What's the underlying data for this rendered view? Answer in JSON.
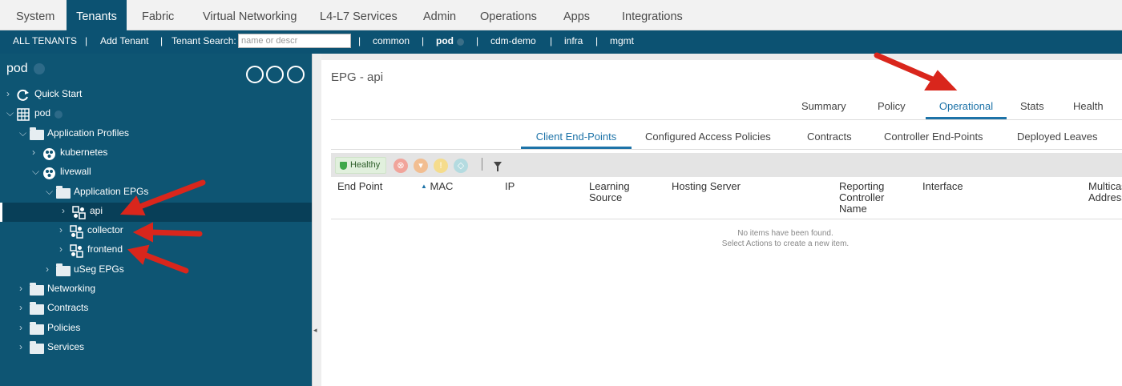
{
  "topnav": {
    "items": [
      "System",
      "Tenants",
      "Fabric",
      "Virtual Networking",
      "L4-L7 Services",
      "Admin",
      "Operations",
      "Apps",
      "Integrations"
    ],
    "active": "Tenants"
  },
  "subnav": {
    "all_tenants": "ALL TENANTS",
    "add_tenant": "Add Tenant",
    "tenant_search_label": "Tenant Search:",
    "search_placeholder": "name or descr",
    "tenants": [
      "common",
      "pod",
      "cdm-demo",
      "infra",
      "mgmt"
    ],
    "separator": "|"
  },
  "left_panel": {
    "title": "pod",
    "tree": [
      {
        "label": "Quick Start",
        "level": 0,
        "icon": "quick-start-icon",
        "chevron": "right"
      },
      {
        "label": "pod",
        "level": 0,
        "icon": "tenant-grid-icon",
        "chevron": "down"
      },
      {
        "label": "Application Profiles",
        "level": 1,
        "icon": "folder-icon",
        "chevron": "down"
      },
      {
        "label": "kubernetes",
        "level": 2,
        "icon": "app-profile-icon",
        "chevron": "right"
      },
      {
        "label": "livewall",
        "level": 2,
        "icon": "app-profile-icon",
        "chevron": "down"
      },
      {
        "label": "Application EPGs",
        "level": 3,
        "icon": "folder-icon",
        "chevron": "down"
      },
      {
        "label": "api",
        "level": 4,
        "icon": "epg-icon",
        "chevron": "right",
        "selected": true
      },
      {
        "label": "collector",
        "level": 4,
        "icon": "epg-icon",
        "chevron": "right"
      },
      {
        "label": "frontend",
        "level": 4,
        "icon": "epg-icon",
        "chevron": "right"
      },
      {
        "label": "uSeg EPGs",
        "level": 3,
        "icon": "folder-icon",
        "chevron": "right"
      },
      {
        "label": "Networking",
        "level": 1,
        "icon": "folder-icon",
        "chevron": "right"
      },
      {
        "label": "Contracts",
        "level": 1,
        "icon": "folder-icon",
        "chevron": "right"
      },
      {
        "label": "Policies",
        "level": 1,
        "icon": "folder-icon",
        "chevron": "right"
      },
      {
        "label": "Services",
        "level": 1,
        "icon": "folder-icon",
        "chevron": "right"
      }
    ]
  },
  "main": {
    "title": "EPG - api",
    "tabs": [
      "Summary",
      "Policy",
      "Operational",
      "Stats",
      "Health"
    ],
    "active_tab": "Operational",
    "subtabs": [
      "Client End-Points",
      "Configured Access Policies",
      "Contracts",
      "Controller End-Points",
      "Deployed Leaves"
    ],
    "active_subtab": "Client End-Points",
    "health_label": "Healthy",
    "columns": [
      "End Point",
      "MAC",
      "IP",
      "Learning Source",
      "Hosting Server",
      "Reporting Controller Name",
      "Interface",
      "Multicast Address"
    ],
    "empty_line1": "No items have been found.",
    "empty_line2": "Select Actions to create a new item."
  },
  "colors": {
    "brand": "#0c5272",
    "left_bg": "#0e5573",
    "accent": "#1d73a8",
    "annotation": "#d9261c"
  }
}
